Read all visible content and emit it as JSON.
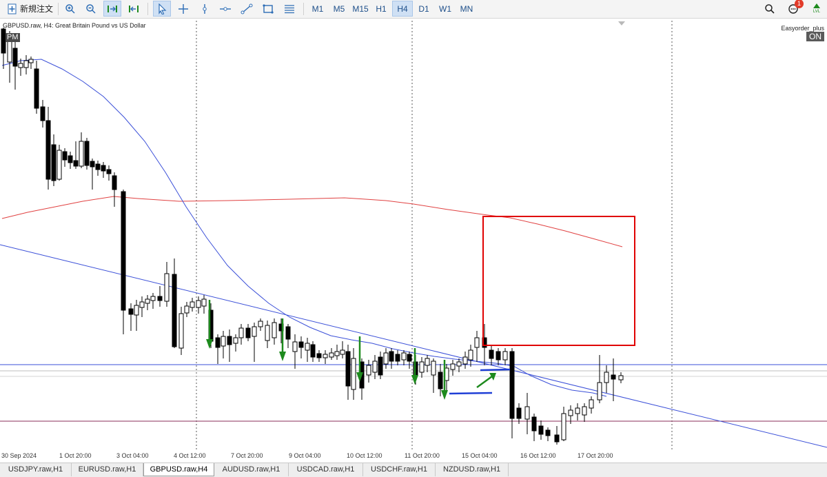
{
  "toolbar": {
    "new_order_label": "新規注文",
    "timeframes": [
      "M1",
      "M5",
      "M15",
      "H1",
      "H4",
      "D1",
      "W1",
      "MN"
    ],
    "active_timeframe": "H4",
    "notification_count": "1",
    "lvl_label": "LVL"
  },
  "chart": {
    "title": "GBPUSD.raw, H4:  Great Britain Pound vs US Dollar",
    "session_label": "PM",
    "ea_name": "Easyorder_plus",
    "ea_status": "ON",
    "time_ticks": [
      "30 Sep 2024",
      "1 Oct 20:00",
      "3 Oct 04:00",
      "4 Oct 12:00",
      "7 Oct 20:00",
      "9 Oct 04:00",
      "10 Oct 12:00",
      "11 Oct 20:00",
      "15 Oct 04:00",
      "16 Oct 12:00",
      "17 Oct 20:00"
    ],
    "colors": {
      "bull_body": "#ffffff",
      "bear_body": "#000000",
      "ma_fast": "#3a4fd8",
      "ma_slow": "#e04040",
      "trendline": "#3a4fd8",
      "support_line": "#8a2d5a",
      "arrows": "#1d8a1d",
      "zone_box": "#e00000"
    }
  },
  "tabs": {
    "items": [
      "USDJPY.raw,H1",
      "EURUSD.raw,H1",
      "GBPUSD.raw,H4",
      "AUDUSD.raw,H1",
      "USDCAD.raw,H1",
      "USDCHF.raw,H1",
      "NZDUSD.raw,H1"
    ],
    "active": "GBPUSD.raw,H4"
  }
}
